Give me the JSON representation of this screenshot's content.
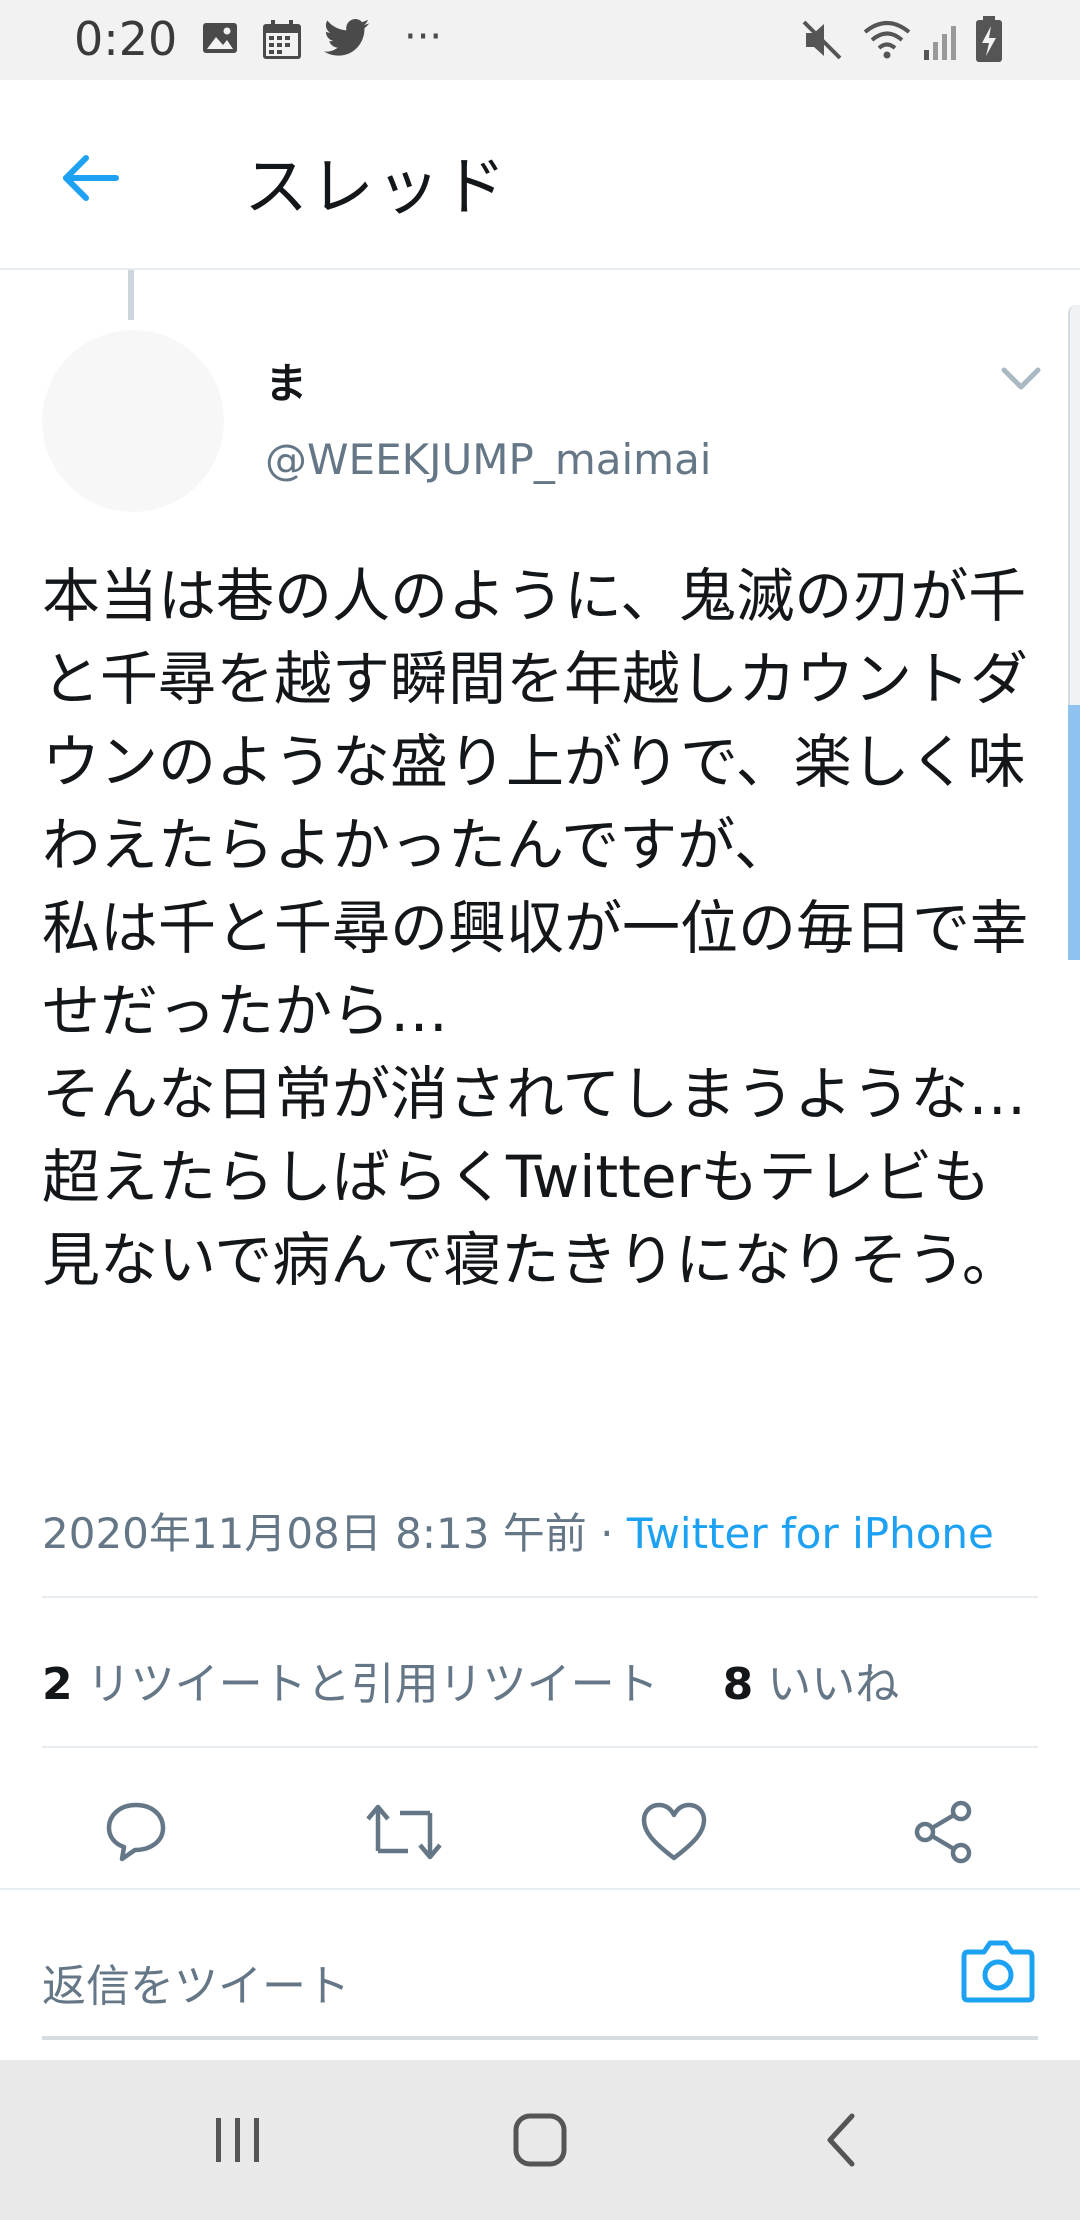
{
  "status_bar": {
    "time": "0:20",
    "left_icons": [
      "image-icon",
      "calendar-icon",
      "twitter-bird-icon",
      "more-dots-icon"
    ],
    "right_icons": [
      "mute-icon",
      "wifi-icon",
      "signal-icon",
      "battery-charging-icon"
    ]
  },
  "header": {
    "title": "スレッド"
  },
  "tweet": {
    "author_name": "ま",
    "author_handle": "@WEEKJUMP_maimai",
    "text": "本当は巷の人のように、鬼滅の刃が千と千尋を越す瞬間を年越しカウントダウンのような盛り上がりで、楽しく味わえたらよかったんですが、\n私は千と千尋の興収が一位の毎日で幸せだったから…\nそんな日常が消されてしまうような…超えたらしばらくTwitterもテレビも見ないで病んで寝たきりになりそう。",
    "date": "2020年11月08日 8:13 午前",
    "separator": "·",
    "source": "Twitter for iPhone"
  },
  "stats": {
    "retweets_count": "2",
    "retweets_label": "リツイートと引用リツイート",
    "likes_count": "8",
    "likes_label": "いいね"
  },
  "actions": [
    "reply-icon",
    "retweet-icon",
    "like-icon",
    "share-icon"
  ],
  "reply": {
    "placeholder": "返信をツイート"
  },
  "colors": {
    "accent": "#1da1f2",
    "text_primary": "#14171a",
    "text_secondary": "#657786",
    "divider": "#e6ecf0"
  },
  "nav_bar": {
    "buttons": [
      "recent-apps-icon",
      "home-icon",
      "back-nav-icon"
    ]
  }
}
